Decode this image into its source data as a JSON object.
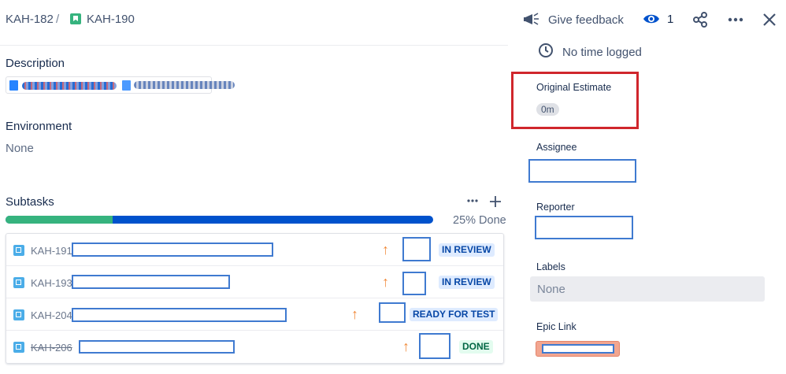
{
  "breadcrumb": {
    "parent": "KAH-182",
    "separator": "/",
    "current": "KAH-190"
  },
  "header": {
    "feedback_label": "Give feedback",
    "watch_count": "1"
  },
  "main": {
    "description_title": "Description",
    "environment_title": "Environment",
    "environment_value": "None",
    "subtasks_title": "Subtasks",
    "progress_percent": 25,
    "progress_text": "25% Done",
    "subtasks": [
      {
        "key": "KAH-191",
        "status": "IN REVIEW",
        "done": false
      },
      {
        "key": "KAH-193",
        "status": "IN REVIEW",
        "done": false
      },
      {
        "key": "KAH-204",
        "status": "READY FOR TEST",
        "done": false
      },
      {
        "key": "KAH-206",
        "status": "DONE",
        "done": true
      }
    ]
  },
  "sidebar": {
    "time_tracking_value": "No time logged",
    "original_estimate_label": "Original Estimate",
    "original_estimate_value": "0m",
    "assignee_label": "Assignee",
    "reporter_label": "Reporter",
    "labels_label": "Labels",
    "labels_value": "None",
    "epic_link_label": "Epic Link"
  },
  "colors": {
    "progress_done": "#36b37e",
    "progress_remaining": "#0052cc",
    "highlight": "#d0262c",
    "redaction": "#3f7ad0",
    "priority_high": "#f08a3a"
  }
}
